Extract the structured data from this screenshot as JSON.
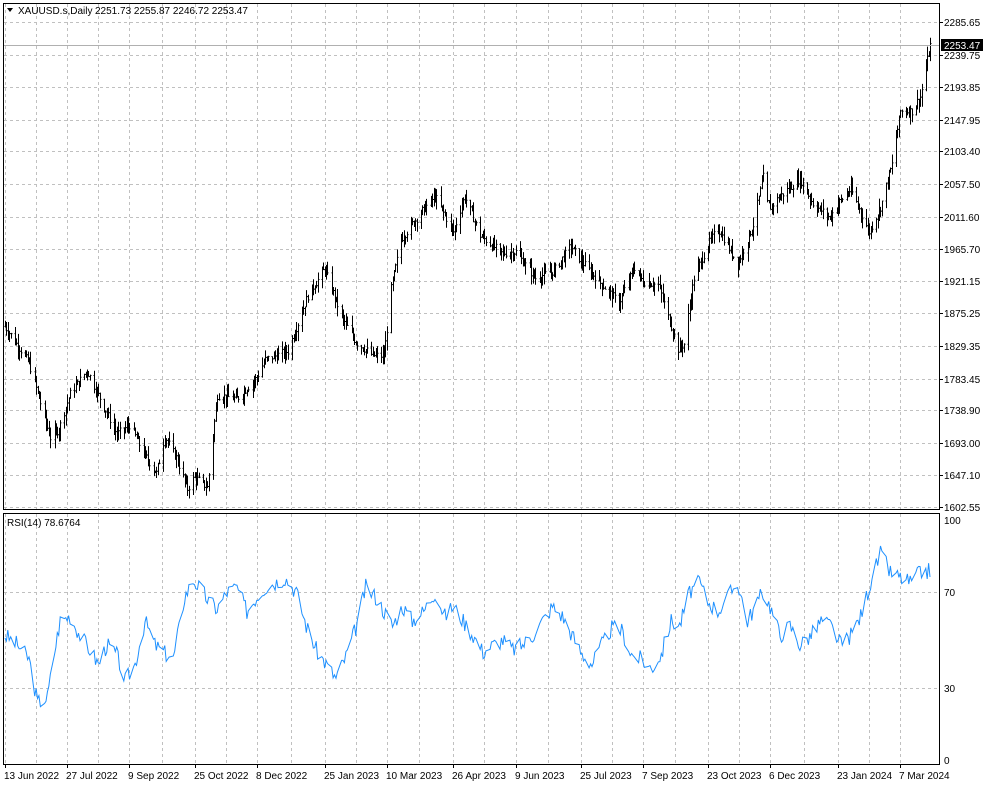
{
  "chart_data": [
    {
      "type": "bar",
      "subtype": "ohlc-bars",
      "title": "XAUUSD.s,Daily",
      "ohlc_readout": "2251.73 2255.87 2246.72 2253.47",
      "last_price_label": "2253.47",
      "last_price": 2253.47,
      "y_ticks": [
        "1602.55",
        "1647.10",
        "1693.00",
        "1738.90",
        "1783.45",
        "1829.35",
        "1875.25",
        "1921.15",
        "1965.70",
        "2011.60",
        "2057.50",
        "2103.40",
        "2147.95",
        "2193.85",
        "2239.75",
        "2285.65"
      ],
      "ylim": [
        1602.55,
        2285.65
      ],
      "x_ticks": [
        "13 Jun 2022",
        "27 Jul 2022",
        "9 Sep 2022",
        "25 Oct 2022",
        "8 Dec 2022",
        "25 Jan 2023",
        "10 Mar 2023",
        "26 Apr 2023",
        "9 Jun 2023",
        "25 Jul 2023",
        "7 Sep 2023",
        "23 Oct 2023",
        "6 Dec 2023",
        "23 Jan 2024",
        "7 Mar 2024"
      ],
      "x_range": [
        "2022-06-13",
        "2024-03-28"
      ],
      "grid": true,
      "series": [
        {
          "dates": [
            "2022-06-13",
            "2022-06-30",
            "2022-07-15",
            "2022-07-21",
            "2022-07-29",
            "2022-08-10",
            "2022-08-18",
            "2022-08-31",
            "2022-09-09",
            "2022-09-20",
            "2022-09-28",
            "2022-10-04",
            "2022-10-12",
            "2022-10-20",
            "2022-10-25",
            "2022-11-03",
            "2022-11-10",
            "2022-11-24",
            "2022-12-08",
            "2022-12-14",
            "2022-12-30",
            "2023-01-13",
            "2023-01-25",
            "2023-02-06",
            "2023-02-16",
            "2023-02-28",
            "2023-03-08",
            "2023-03-13",
            "2023-03-20",
            "2023-04-04",
            "2023-04-13",
            "2023-04-26",
            "2023-05-04",
            "2023-05-15",
            "2023-05-30",
            "2023-06-09",
            "2023-06-23",
            "2023-07-06",
            "2023-07-18",
            "2023-07-25",
            "2023-08-08",
            "2023-08-21",
            "2023-09-01",
            "2023-09-07",
            "2023-09-18",
            "2023-10-02",
            "2023-10-06",
            "2023-10-13",
            "2023-10-23",
            "2023-10-30",
            "2023-11-13",
            "2023-11-24",
            "2023-12-01",
            "2023-12-04",
            "2023-12-06",
            "2023-12-13",
            "2023-12-27",
            "2024-01-05",
            "2024-01-17",
            "2024-01-23",
            "2024-02-01",
            "2024-02-14",
            "2024-02-22",
            "2024-03-01",
            "2024-03-07",
            "2024-03-15",
            "2024-03-21",
            "2024-03-28"
          ],
          "close": [
            1857,
            1805,
            1700,
            1712,
            1762,
            1795,
            1760,
            1705,
            1718,
            1675,
            1650,
            1702,
            1672,
            1628,
            1645,
            1630,
            1760,
            1755,
            1785,
            1810,
            1822,
            1900,
            1938,
            1870,
            1835,
            1816,
            1815,
            1910,
            1980,
            2020,
            2040,
            1990,
            2040,
            1985,
            1960,
            1962,
            1925,
            1935,
            1970,
            1950,
            1918,
            1890,
            1940,
            1920,
            1915,
            1825,
            1832,
            1925,
            1972,
            1995,
            1945,
            2000,
            2067,
            2030,
            2025,
            2040,
            2065,
            2030,
            2010,
            2030,
            2050,
            1990,
            2025,
            2085,
            2160,
            2160,
            2180,
            2253
          ]
        }
      ]
    },
    {
      "type": "line",
      "title": "RSI(14) 78.6764",
      "y_ticks": [
        "0",
        "30",
        "70",
        "100"
      ],
      "ylim": [
        0,
        100
      ],
      "grid": true,
      "series": [
        {
          "name": "RSI(14)",
          "color": "#1e90ff",
          "dates": [
            "2022-06-13",
            "2022-06-22",
            "2022-06-30",
            "2022-07-06",
            "2022-07-13",
            "2022-07-18",
            "2022-07-22",
            "2022-07-29",
            "2022-08-05",
            "2022-08-12",
            "2022-08-18",
            "2022-08-24",
            "2022-08-31",
            "2022-09-06",
            "2022-09-13",
            "2022-09-20",
            "2022-09-27",
            "2022-10-03",
            "2022-10-10",
            "2022-10-18",
            "2022-10-24",
            "2022-10-31",
            "2022-11-04",
            "2022-11-10",
            "2022-11-17",
            "2022-11-24",
            "2022-12-01",
            "2022-12-08",
            "2022-12-14",
            "2022-12-21",
            "2022-12-28",
            "2023-01-05",
            "2023-01-12",
            "2023-01-19",
            "2023-01-26",
            "2023-02-02",
            "2023-02-09",
            "2023-02-16",
            "2023-02-23",
            "2023-03-02",
            "2023-03-08",
            "2023-03-14",
            "2023-03-21",
            "2023-03-28",
            "2023-04-05",
            "2023-04-13",
            "2023-04-20",
            "2023-04-26",
            "2023-05-03",
            "2023-05-10",
            "2023-05-17",
            "2023-05-24",
            "2023-05-31",
            "2023-06-07",
            "2023-06-14",
            "2023-06-21",
            "2023-06-28",
            "2023-07-05",
            "2023-07-12",
            "2023-07-19",
            "2023-07-26",
            "2023-08-02",
            "2023-08-09",
            "2023-08-16",
            "2023-08-23",
            "2023-08-30",
            "2023-09-06",
            "2023-09-13",
            "2023-09-20",
            "2023-09-27",
            "2023-10-03",
            "2023-10-10",
            "2023-10-17",
            "2023-10-23",
            "2023-10-30",
            "2023-11-06",
            "2023-11-13",
            "2023-11-20",
            "2023-11-27",
            "2023-12-01",
            "2023-12-06",
            "2023-12-13",
            "2023-12-20",
            "2023-12-27",
            "2024-01-04",
            "2024-01-11",
            "2024-01-18",
            "2024-01-25",
            "2024-02-01",
            "2024-02-08",
            "2024-02-15",
            "2024-02-22",
            "2024-02-29",
            "2024-03-07",
            "2024-03-14",
            "2024-03-21",
            "2024-03-28"
          ],
          "values": [
            52,
            48,
            42,
            24,
            26,
            45,
            58,
            60,
            52,
            46,
            40,
            48,
            44,
            33,
            40,
            58,
            48,
            45,
            42,
            68,
            75,
            70,
            66,
            63,
            70,
            72,
            62,
            68,
            72,
            74,
            76,
            70,
            56,
            46,
            40,
            34,
            43,
            55,
            72,
            68,
            62,
            56,
            64,
            58,
            62,
            70,
            60,
            64,
            58,
            52,
            45,
            48,
            50,
            46,
            48,
            52,
            58,
            64,
            60,
            52,
            44,
            40,
            48,
            55,
            54,
            44,
            42,
            38,
            44,
            58,
            56,
            70,
            74,
            66,
            62,
            68,
            74,
            58,
            66,
            70,
            64,
            52,
            56,
            48,
            52,
            58,
            56,
            48,
            52,
            60,
            74,
            86,
            78,
            76,
            74,
            78,
            79
          ]
        }
      ]
    }
  ]
}
